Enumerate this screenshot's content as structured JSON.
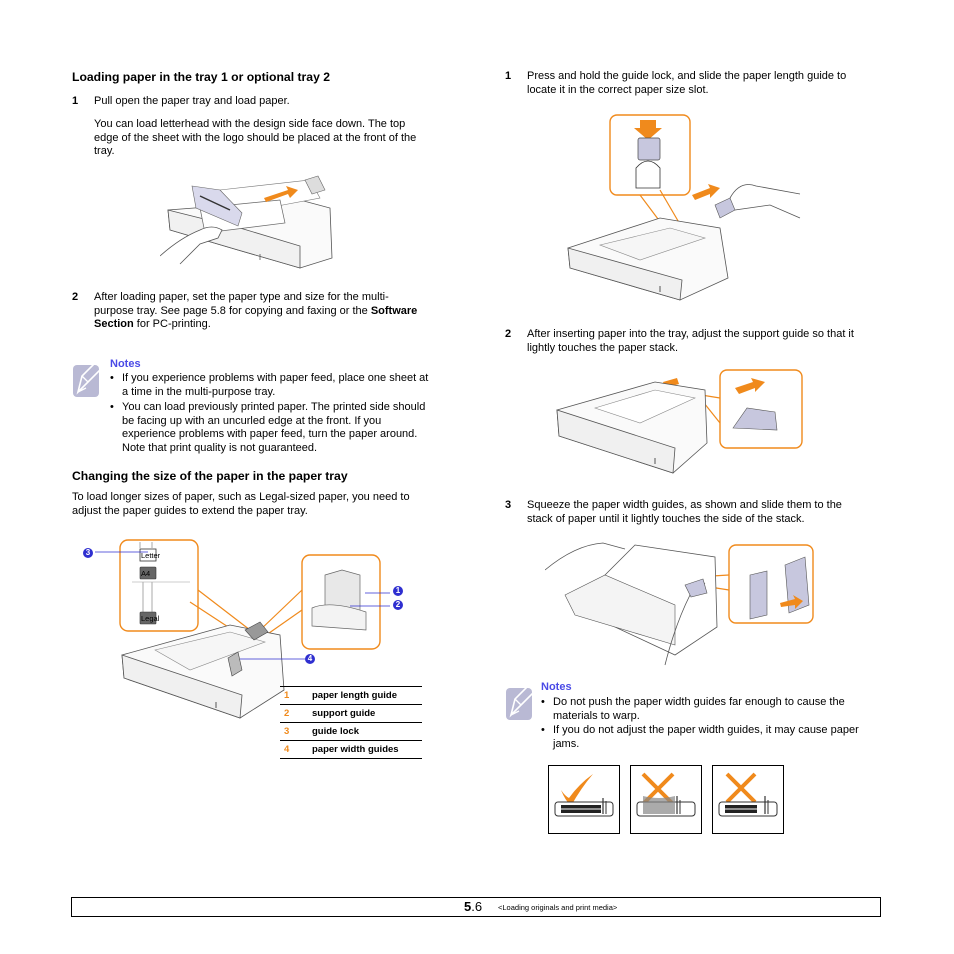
{
  "left_column": {
    "section1": {
      "heading": "Loading paper in the tray 1 or optional tray 2",
      "steps": [
        {
          "number": "1",
          "text": "Pull open the paper tray and load paper."
        },
        {
          "number": "2",
          "text_parts": [
            "After loading paper, set the paper type and size for the multi-",
            "purpose tray. See page 5.8 for copying and faxing or the ",
            "Software",
            "Section",
            " for PC-printing."
          ]
        }
      ],
      "step1_detail": [
        "You can load letterhead with the design side face down. The top",
        "edge of the sheet with the logo should be placed at the front of the",
        "tray."
      ],
      "figure_caption": "paper tray loading illustration"
    },
    "notes1": {
      "title": "Notes",
      "bullets": [
        [
          "If you experience problems with paper feed, place one sheet at",
          "a time in the multi-purpose tray."
        ],
        [
          "You can load previously printed paper. The printed side should",
          "be facing up with an uncurled edge at the front. If you",
          "experience problems with paper feed, turn the paper around.",
          "Note that print quality is not guaranteed."
        ]
      ]
    },
    "section2": {
      "heading": "Changing the size of the paper in the paper tray",
      "intro": [
        "To load longer sizes of paper, such as Legal-sized paper, you need to",
        "adjust the paper guides to extend the paper tray."
      ],
      "size_labels": [
        "Letter",
        "A4",
        "Legal"
      ],
      "callouts": [
        "1",
        "2",
        "3",
        "4"
      ],
      "legend": [
        {
          "number": "1",
          "label": "paper length guide"
        },
        {
          "number": "2",
          "label": "support guide"
        },
        {
          "number": "3",
          "label": "guide lock"
        },
        {
          "number": "4",
          "label": "paper width guides"
        }
      ]
    }
  },
  "right_column": {
    "steps": [
      {
        "number": "1",
        "lines": [
          "Press and hold the guide lock, and slide the paper length guide to",
          "locate it in the correct paper size slot."
        ]
      },
      {
        "number": "2",
        "lines": [
          "After inserting paper into the tray, adjust the support guide so that it",
          "lightly touches the paper stack."
        ]
      },
      {
        "number": "3",
        "lines": [
          "Squeeze the paper width guides, as shown and slide them to the",
          "stack of paper until it lightly touches the side of the stack."
        ]
      }
    ],
    "notes2": {
      "title": "Notes",
      "bullets": [
        [
          "Do not push the paper width guides far enough to cause the",
          "materials to warp."
        ],
        [
          "If you do not adjust the paper width guides, it may cause paper",
          "jams."
        ]
      ]
    },
    "examples": [
      {
        "result": "correct",
        "icon": "checkmark-icon"
      },
      {
        "result": "incorrect",
        "icon": "cross-icon"
      },
      {
        "result": "incorrect",
        "icon": "cross-icon"
      }
    ]
  },
  "footer": {
    "chapter": "5",
    "page": ".6",
    "section": "<Loading originals and print media>"
  },
  "colors": {
    "accent_orange": "#f08a1c",
    "notes_blue": "#4a4ae6",
    "callout_blue": "#2f2fd0",
    "notes_icon": "#b9b9d4"
  }
}
